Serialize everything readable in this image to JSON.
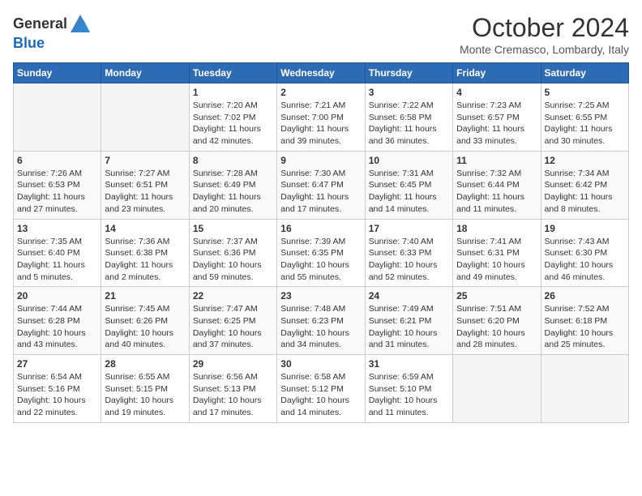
{
  "header": {
    "logo_general": "General",
    "logo_blue": "Blue",
    "month": "October 2024",
    "location": "Monte Cremasco, Lombardy, Italy"
  },
  "weekdays": [
    "Sunday",
    "Monday",
    "Tuesday",
    "Wednesday",
    "Thursday",
    "Friday",
    "Saturday"
  ],
  "weeks": [
    [
      {
        "day": "",
        "info": ""
      },
      {
        "day": "",
        "info": ""
      },
      {
        "day": "1",
        "info": "Sunrise: 7:20 AM\nSunset: 7:02 PM\nDaylight: 11 hours and 42 minutes."
      },
      {
        "day": "2",
        "info": "Sunrise: 7:21 AM\nSunset: 7:00 PM\nDaylight: 11 hours and 39 minutes."
      },
      {
        "day": "3",
        "info": "Sunrise: 7:22 AM\nSunset: 6:58 PM\nDaylight: 11 hours and 36 minutes."
      },
      {
        "day": "4",
        "info": "Sunrise: 7:23 AM\nSunset: 6:57 PM\nDaylight: 11 hours and 33 minutes."
      },
      {
        "day": "5",
        "info": "Sunrise: 7:25 AM\nSunset: 6:55 PM\nDaylight: 11 hours and 30 minutes."
      }
    ],
    [
      {
        "day": "6",
        "info": "Sunrise: 7:26 AM\nSunset: 6:53 PM\nDaylight: 11 hours and 27 minutes."
      },
      {
        "day": "7",
        "info": "Sunrise: 7:27 AM\nSunset: 6:51 PM\nDaylight: 11 hours and 23 minutes."
      },
      {
        "day": "8",
        "info": "Sunrise: 7:28 AM\nSunset: 6:49 PM\nDaylight: 11 hours and 20 minutes."
      },
      {
        "day": "9",
        "info": "Sunrise: 7:30 AM\nSunset: 6:47 PM\nDaylight: 11 hours and 17 minutes."
      },
      {
        "day": "10",
        "info": "Sunrise: 7:31 AM\nSunset: 6:45 PM\nDaylight: 11 hours and 14 minutes."
      },
      {
        "day": "11",
        "info": "Sunrise: 7:32 AM\nSunset: 6:44 PM\nDaylight: 11 hours and 11 minutes."
      },
      {
        "day": "12",
        "info": "Sunrise: 7:34 AM\nSunset: 6:42 PM\nDaylight: 11 hours and 8 minutes."
      }
    ],
    [
      {
        "day": "13",
        "info": "Sunrise: 7:35 AM\nSunset: 6:40 PM\nDaylight: 11 hours and 5 minutes."
      },
      {
        "day": "14",
        "info": "Sunrise: 7:36 AM\nSunset: 6:38 PM\nDaylight: 11 hours and 2 minutes."
      },
      {
        "day": "15",
        "info": "Sunrise: 7:37 AM\nSunset: 6:36 PM\nDaylight: 10 hours and 59 minutes."
      },
      {
        "day": "16",
        "info": "Sunrise: 7:39 AM\nSunset: 6:35 PM\nDaylight: 10 hours and 55 minutes."
      },
      {
        "day": "17",
        "info": "Sunrise: 7:40 AM\nSunset: 6:33 PM\nDaylight: 10 hours and 52 minutes."
      },
      {
        "day": "18",
        "info": "Sunrise: 7:41 AM\nSunset: 6:31 PM\nDaylight: 10 hours and 49 minutes."
      },
      {
        "day": "19",
        "info": "Sunrise: 7:43 AM\nSunset: 6:30 PM\nDaylight: 10 hours and 46 minutes."
      }
    ],
    [
      {
        "day": "20",
        "info": "Sunrise: 7:44 AM\nSunset: 6:28 PM\nDaylight: 10 hours and 43 minutes."
      },
      {
        "day": "21",
        "info": "Sunrise: 7:45 AM\nSunset: 6:26 PM\nDaylight: 10 hours and 40 minutes."
      },
      {
        "day": "22",
        "info": "Sunrise: 7:47 AM\nSunset: 6:25 PM\nDaylight: 10 hours and 37 minutes."
      },
      {
        "day": "23",
        "info": "Sunrise: 7:48 AM\nSunset: 6:23 PM\nDaylight: 10 hours and 34 minutes."
      },
      {
        "day": "24",
        "info": "Sunrise: 7:49 AM\nSunset: 6:21 PM\nDaylight: 10 hours and 31 minutes."
      },
      {
        "day": "25",
        "info": "Sunrise: 7:51 AM\nSunset: 6:20 PM\nDaylight: 10 hours and 28 minutes."
      },
      {
        "day": "26",
        "info": "Sunrise: 7:52 AM\nSunset: 6:18 PM\nDaylight: 10 hours and 25 minutes."
      }
    ],
    [
      {
        "day": "27",
        "info": "Sunrise: 6:54 AM\nSunset: 5:16 PM\nDaylight: 10 hours and 22 minutes."
      },
      {
        "day": "28",
        "info": "Sunrise: 6:55 AM\nSunset: 5:15 PM\nDaylight: 10 hours and 19 minutes."
      },
      {
        "day": "29",
        "info": "Sunrise: 6:56 AM\nSunset: 5:13 PM\nDaylight: 10 hours and 17 minutes."
      },
      {
        "day": "30",
        "info": "Sunrise: 6:58 AM\nSunset: 5:12 PM\nDaylight: 10 hours and 14 minutes."
      },
      {
        "day": "31",
        "info": "Sunrise: 6:59 AM\nSunset: 5:10 PM\nDaylight: 10 hours and 11 minutes."
      },
      {
        "day": "",
        "info": ""
      },
      {
        "day": "",
        "info": ""
      }
    ]
  ]
}
